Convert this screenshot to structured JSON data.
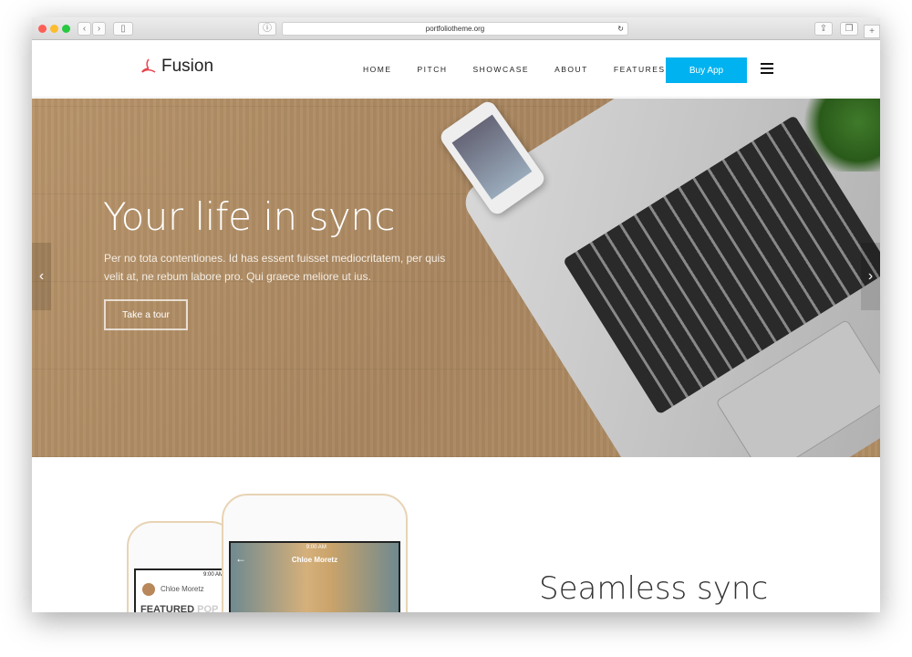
{
  "browser": {
    "url": "portfoliotheme.org"
  },
  "nav": {
    "brand": "Fusion",
    "items": [
      "HOME",
      "PITCH",
      "SHOWCASE",
      "ABOUT",
      "FEATURES"
    ],
    "buy_label": "Buy App",
    "accent": "#00b3f0"
  },
  "hero": {
    "title": "Your life in sync",
    "text": "Per no tota contentiones. Id has essent fuisset mediocritatem, per quis velit at, ne rebum labore pro. Qui graece meliore ut ius.",
    "cta": "Take a tour",
    "prev": "‹",
    "next": "›"
  },
  "section": {
    "title": "Seamless sync",
    "phone_left": {
      "time": "9:00 AM",
      "name": "Chloe Moretz",
      "tab1": "FEATURED",
      "tab2": "POP"
    },
    "phone_right": {
      "time": "9:00 AM",
      "name": "Chloe Moretz"
    }
  }
}
